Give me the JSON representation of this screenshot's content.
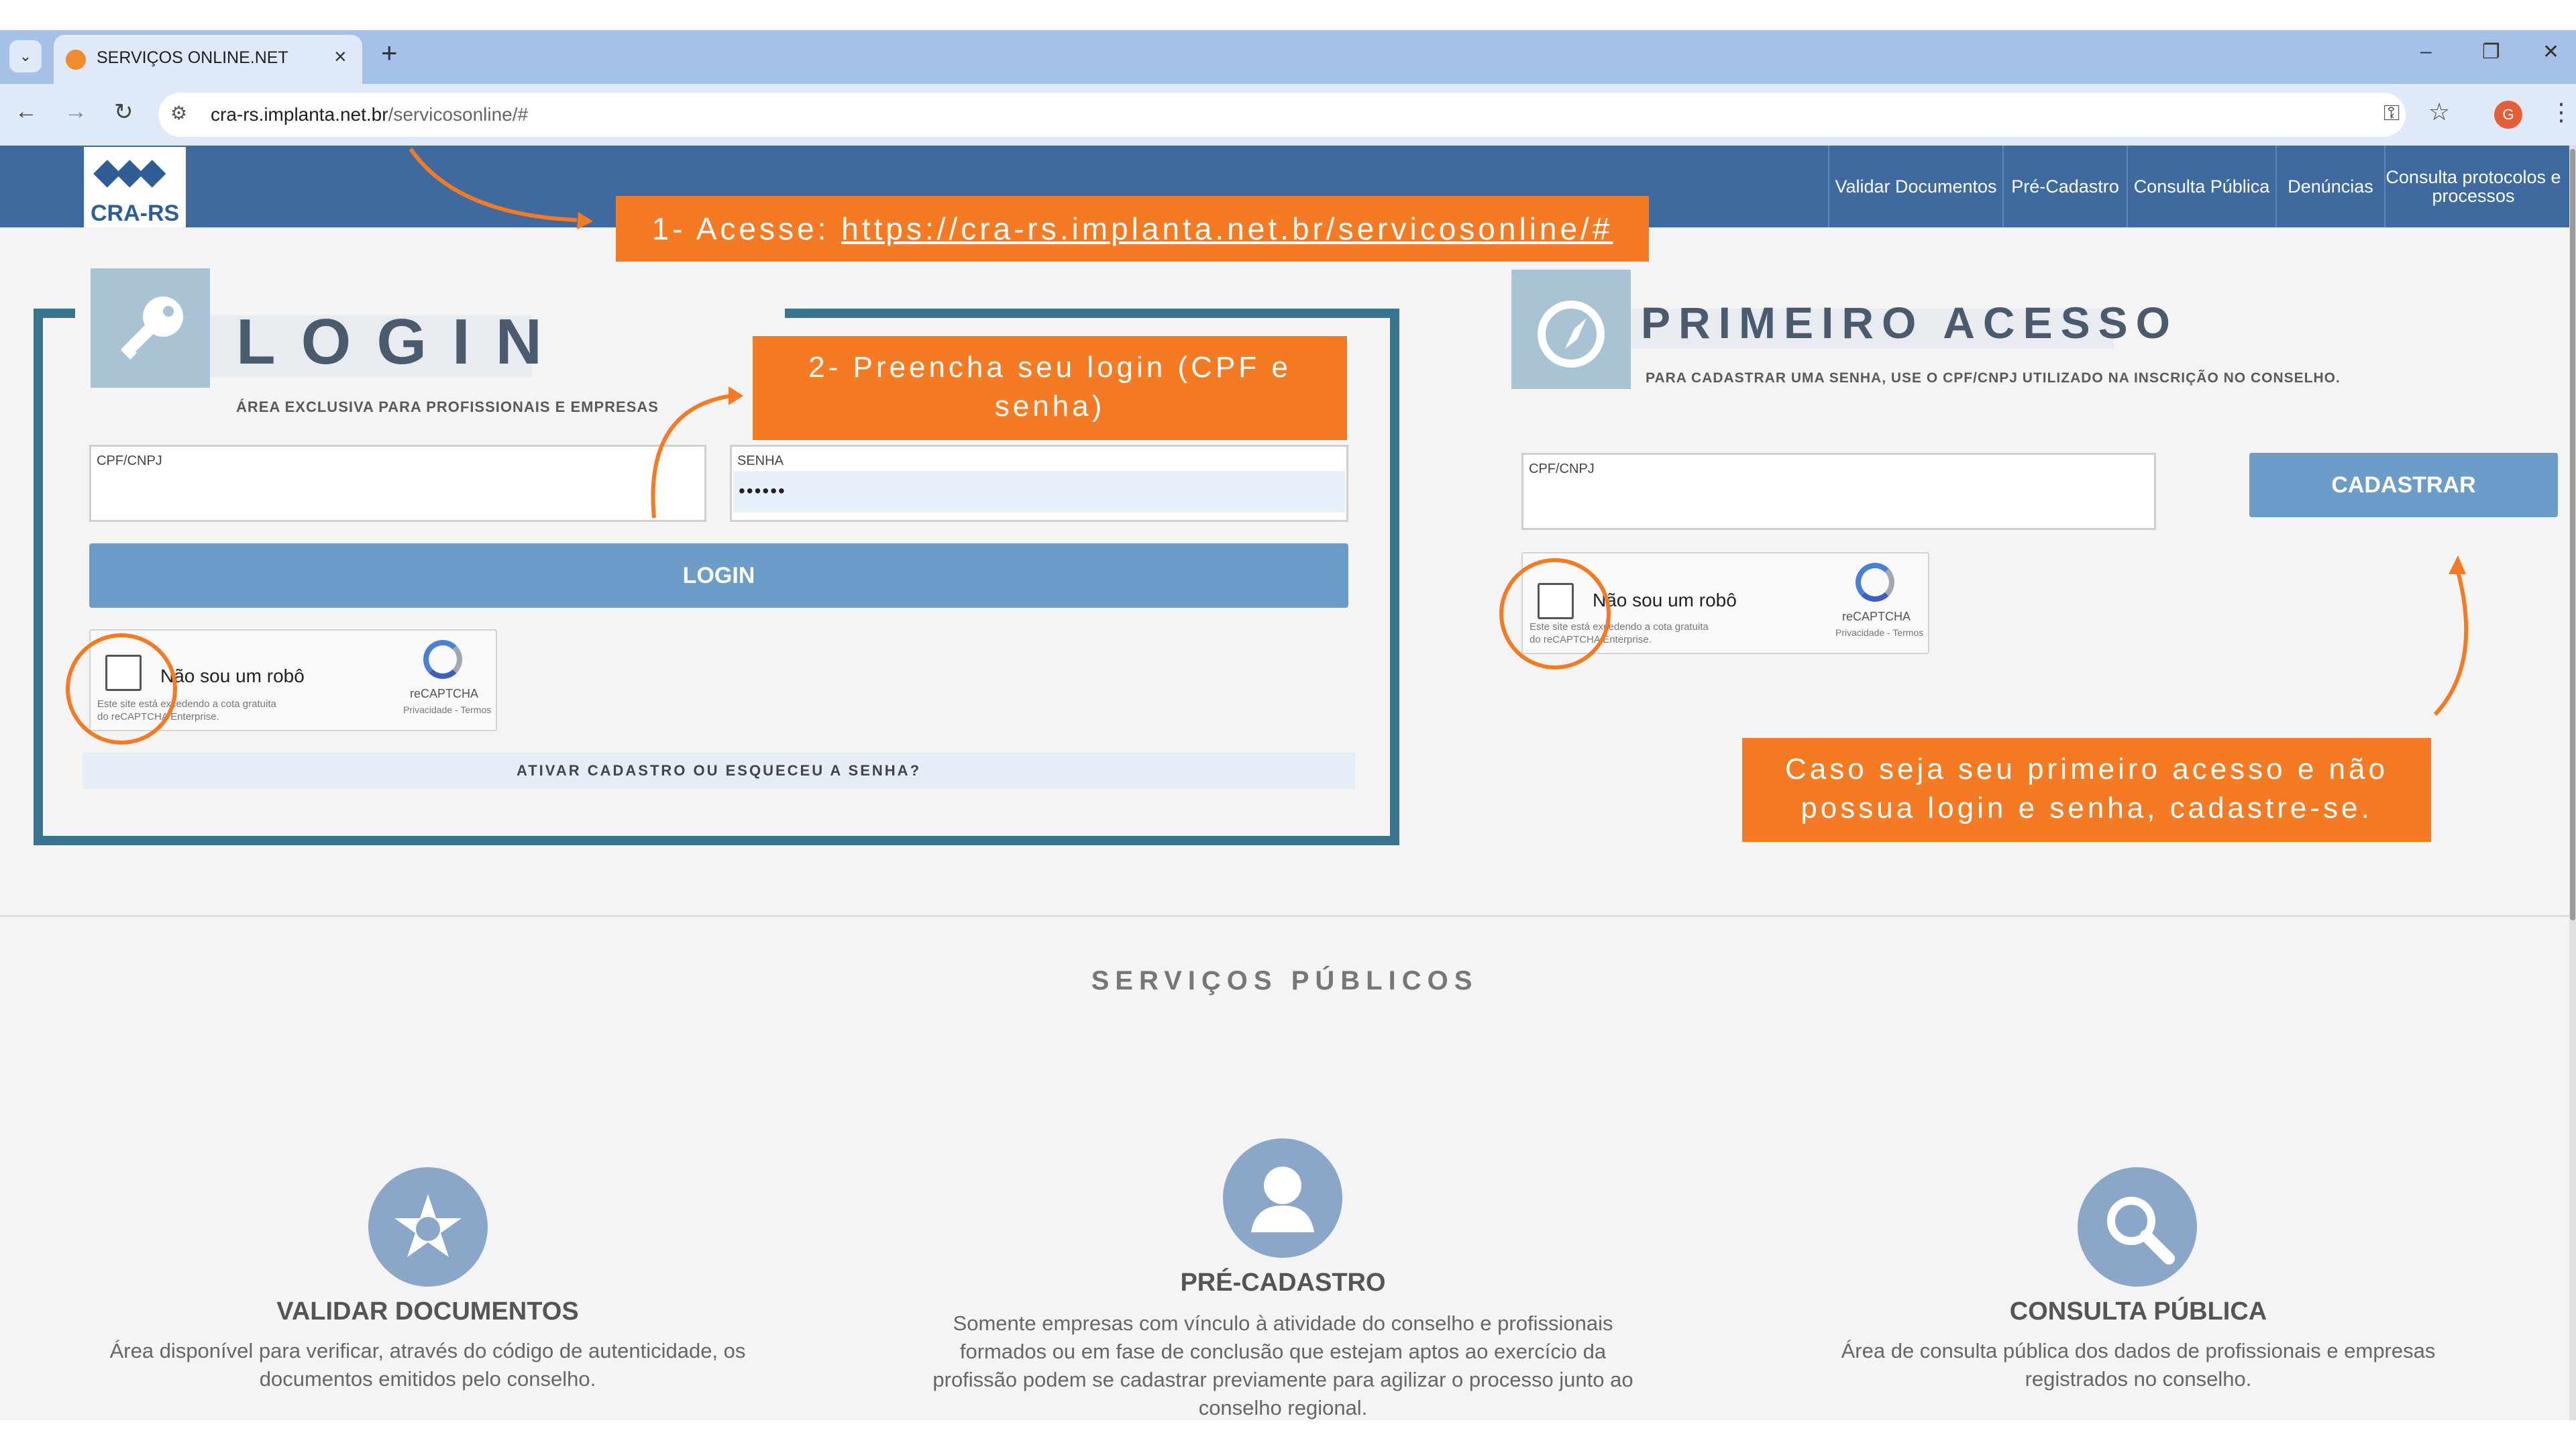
{
  "browser": {
    "tab_title": "SERVIÇOS ONLINE.NET",
    "new_tab": "+",
    "url_host": "cra-rs.implanta.net.br",
    "url_path": "/servicosonline/#",
    "profile_initial": "G"
  },
  "header": {
    "logo_text": "CRA-RS",
    "nav": [
      "Validar Documentos",
      "Pré-Cadastro",
      "Consulta Pública",
      "Denúncias",
      "Consulta protocolos e processos"
    ]
  },
  "login": {
    "title": "LOGIN",
    "subtitle": "ÁREA EXCLUSIVA PARA PROFISSIONAIS E EMPRESAS",
    "cpf_label": "CPF/CNPJ",
    "senha_label": "SENHA",
    "senha_value": "••••••",
    "button": "LOGIN",
    "forgot": "ATIVAR CADASTRO OU ESQUECEU A SENHA?"
  },
  "captcha": {
    "label": "Não sou um robô",
    "fine_line1": "Este site está excedendo a cota gratuita",
    "fine_line2": "do reCAPTCHA Enterprise.",
    "brand": "reCAPTCHA",
    "links": "Privacidade - Termos"
  },
  "primeiro_acesso": {
    "title": "PRIMEIRO ACESSO",
    "subtitle": "PARA CADASTRAR UMA SENHA, USE O CPF/CNPJ UTILIZADO NA INSCRIÇÃO NO CONSELHO.",
    "cpf_label": "CPF/CNPJ",
    "button": "CADASTRAR"
  },
  "servicos": {
    "title": "SERVIÇOS PÚBLICOS",
    "items": [
      {
        "title": "VALIDAR DOCUMENTOS",
        "description": "Área disponível para verificar, através do código de autenticidade, os documentos emitidos pelo conselho.",
        "icon": "seal-icon"
      },
      {
        "title": "PRÉ-CADASTRO",
        "description": "Somente empresas com vínculo à atividade do conselho e profissionais formados ou em fase de conclusão que estejam aptos ao exercício da profissão podem se cadastrar previamente para agilizar o processo junto ao conselho regional.",
        "icon": "user-icon"
      },
      {
        "title": "CONSULTA PÚBLICA",
        "description": "Área de consulta pública dos dados de profissionais e empresas registrados no conselho.",
        "icon": "magnifier-icon"
      }
    ]
  },
  "annotations": {
    "step1_prefix": "1- Acesse: ",
    "step1_link": "https://cra-rs.implanta.net.br/servicosonline/#",
    "step2": "2- Preencha seu login (CPF e senha)",
    "step3": "Caso seja seu primeiro acesso e não possua login e senha, cadastre-se."
  },
  "colors": {
    "header_blue": "#3f6aa0",
    "button_blue": "#6b9dc8",
    "frame_teal": "#3a7590",
    "annotation_orange": "#f47a24"
  }
}
